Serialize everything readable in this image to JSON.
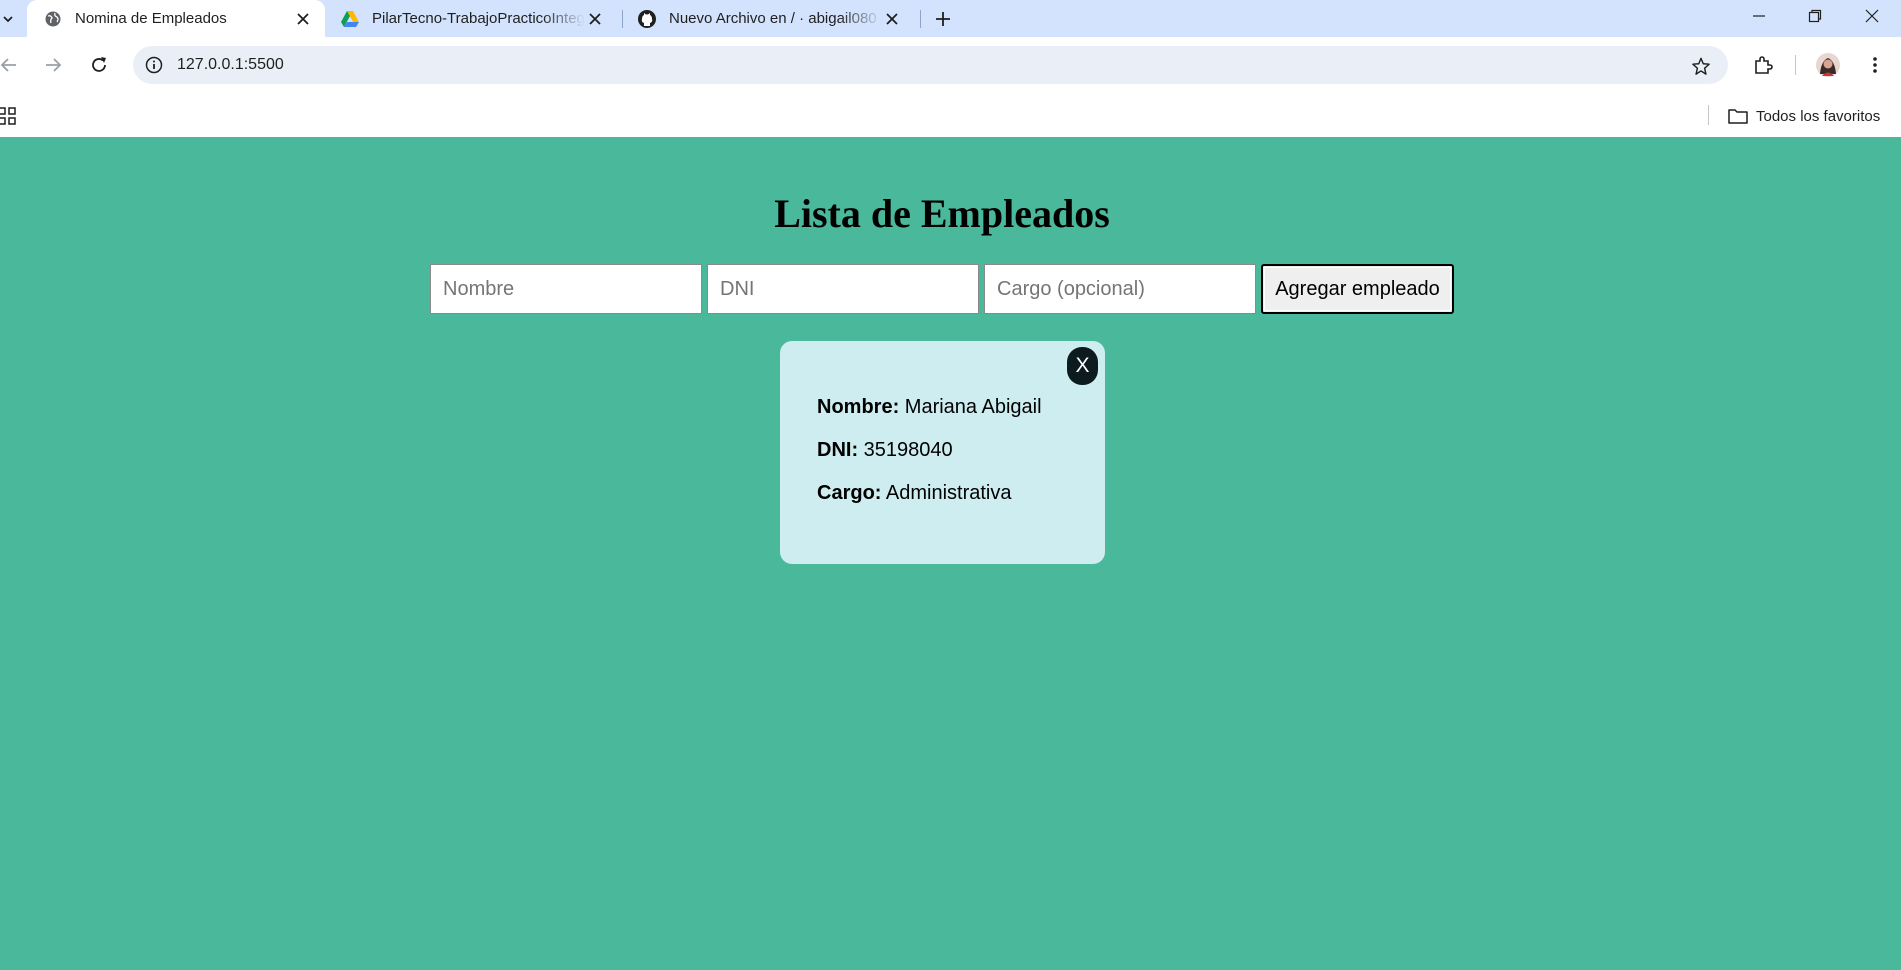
{
  "browser": {
    "tabs": [
      {
        "title": "Nomina de Empleados",
        "icon": "globe-icon",
        "active": true
      },
      {
        "title": "PilarTecno-TrabajoPracticoInteg",
        "icon": "google-drive-icon",
        "active": false
      },
      {
        "title": "Nuevo Archivo en / · abigail080",
        "icon": "github-icon",
        "active": false
      }
    ],
    "url": "127.0.0.1:5500",
    "bookmarks_folder": "Todos los favoritos"
  },
  "page": {
    "title": "Lista de Empleados",
    "form": {
      "nombre_placeholder": "Nombre",
      "dni_placeholder": "DNI",
      "cargo_placeholder": "Cargo (opcional)",
      "add_label": "Agregar empleado"
    },
    "employee": {
      "close_label": "X",
      "nombre_label": "Nombre:",
      "nombre_value": "Mariana Abigail",
      "dni_label": "DNI:",
      "dni_value": "35198040",
      "cargo_label": "Cargo:",
      "cargo_value": "Administrativa"
    }
  },
  "colors": {
    "page_background": "#4ab89b",
    "card_background": "#cdedf1",
    "tabbar_background": "#d3e3fd"
  }
}
